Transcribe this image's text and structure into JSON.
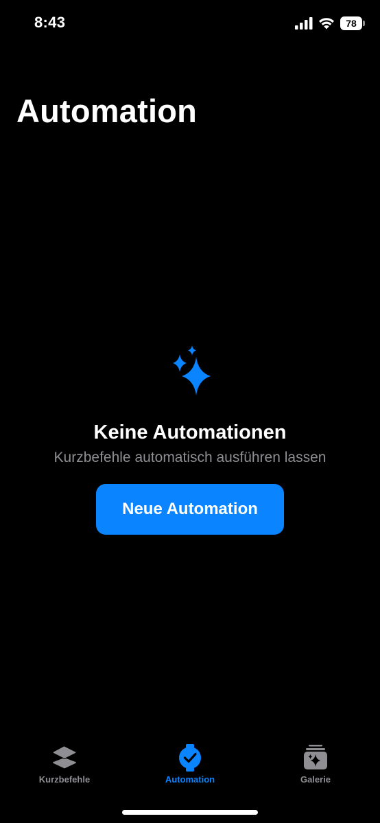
{
  "status_bar": {
    "time": "8:43",
    "battery_level": "78",
    "icons": [
      "cellular-signal-icon",
      "wifi-icon",
      "battery-icon"
    ]
  },
  "page": {
    "title": "Automation"
  },
  "empty_state": {
    "icon": "sparkles-icon",
    "title": "Keine Automationen",
    "subtitle": "Kurzbefehle automatisch ausführen lassen",
    "button_label": "Neue Automation"
  },
  "tab_bar": {
    "tabs": [
      {
        "label": "Kurzbefehle",
        "icon": "stacked-layers-icon",
        "active": false
      },
      {
        "label": "Automation",
        "icon": "clock-check-icon",
        "active": true
      },
      {
        "label": "Galerie",
        "icon": "gallery-sparkle-icon",
        "active": false
      }
    ]
  },
  "colors": {
    "background": "#000000",
    "accent": "#0a84ff",
    "secondary_text": "#8e8e93",
    "icon_inactive": "#8e8e93",
    "sparkles": "#0a84ff"
  }
}
